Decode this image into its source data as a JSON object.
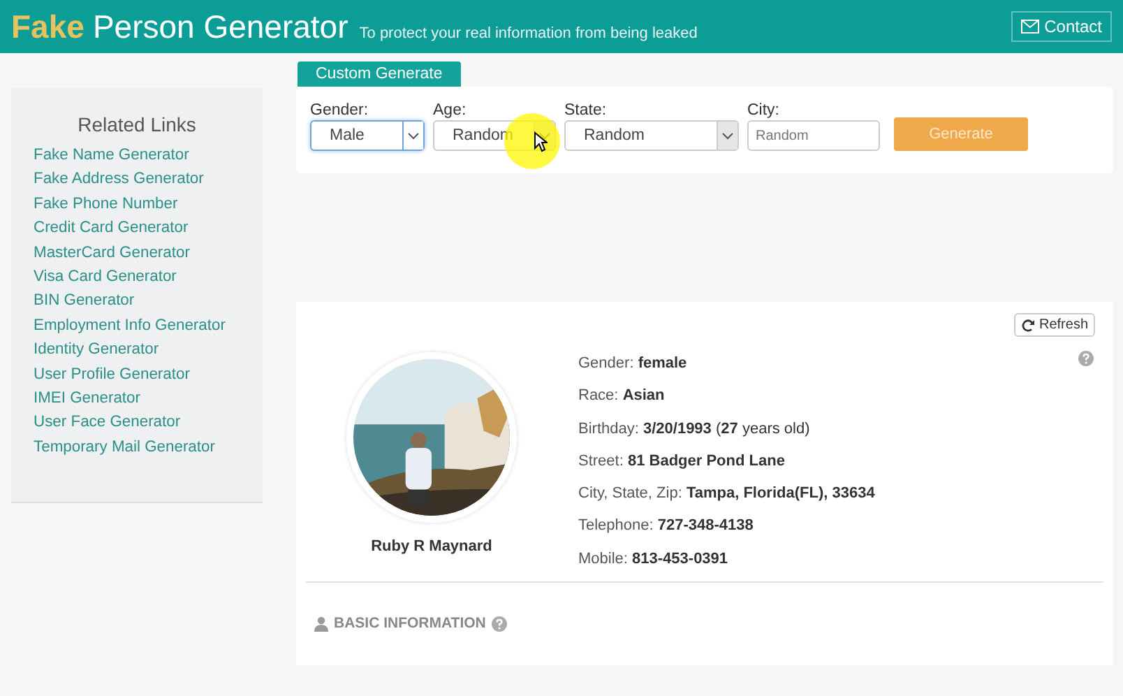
{
  "header": {
    "brand_first": "Fake",
    "brand_rest": "Person Generator",
    "tagline": "To protect your real information from being leaked",
    "contact": "Contact"
  },
  "sidebar": {
    "title": "Related Links",
    "items": [
      "Fake Name Generator",
      "Fake Address Generator",
      "Fake Phone Number",
      "Credit Card Generator",
      "MasterCard Generator",
      "Visa Card Generator",
      "BIN Generator",
      "Employment Info Generator",
      "Identity Generator",
      "User Profile Generator",
      "IMEI Generator",
      "User Face Generator",
      "Temporary Mail Generator"
    ]
  },
  "form": {
    "tab": "Custom Generate",
    "fields": [
      {
        "kind": "select",
        "label": "Gender:",
        "value": "Male",
        "focused": true
      },
      {
        "kind": "select",
        "label": "Age:",
        "value": "Random",
        "focused": false
      },
      {
        "kind": "select",
        "label": "State:",
        "value": "Random",
        "focused": false
      },
      {
        "kind": "input",
        "label": "City:",
        "placeholder": "Random"
      }
    ],
    "button": "Generate"
  },
  "profile": {
    "refresh": "Refresh",
    "name": "Ruby R Maynard",
    "details": [
      {
        "label": "Gender:",
        "value": "**female**"
      },
      {
        "label": "Race:",
        "value": "**Asian**"
      },
      {
        "label": "Birthday:",
        "value": "**3/20/1993** (**27** years old)"
      },
      {
        "label": "Street:",
        "value": "**81 Badger Pond Lane**"
      },
      {
        "label": "City, State, Zip:",
        "value": "**Tampa, Florida(FL), 33634**"
      },
      {
        "label": "Telephone:",
        "value": "**727-348-4138**"
      },
      {
        "label": "Mobile:",
        "value": "**813-453-0391**"
      }
    ],
    "section": "BASIC INFORMATION"
  }
}
